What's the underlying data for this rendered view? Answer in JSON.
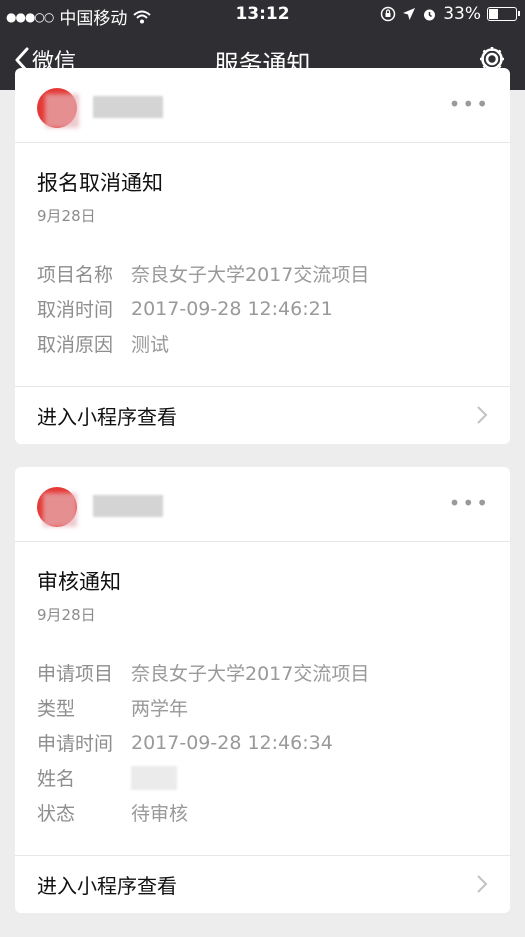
{
  "status_bar": {
    "signal_dots": "●●●○○",
    "carrier": "中国移动",
    "wifi_icon": "wifi-icon",
    "time": "13:12",
    "battery_percent": "33%",
    "battery_level": 0.33
  },
  "nav": {
    "back_label": "微信",
    "title": "服务通知",
    "settings_icon": "gear-icon"
  },
  "cards": [
    {
      "more": "•••",
      "title": "报名取消通知",
      "date": "9月28日",
      "fields": [
        {
          "key": "项目名称",
          "value": "奈良女子大学2017交流项目"
        },
        {
          "key": "取消时间",
          "value": "2017-09-28 12:46:21"
        },
        {
          "key": "取消原因",
          "value": "测试"
        }
      ],
      "footer": "进入小程序查看"
    },
    {
      "more": "•••",
      "title": "审核通知",
      "date": "9月28日",
      "fields": [
        {
          "key": "申请项目",
          "value": "奈良女子大学2017交流项目"
        },
        {
          "key": "类型",
          "value": "两学年"
        },
        {
          "key": "申请时间",
          "value": "2017-09-28 12:46:34"
        },
        {
          "key": "姓名",
          "value": ""
        },
        {
          "key": "状态",
          "value": "待审核"
        }
      ],
      "footer": "进入小程序查看"
    }
  ]
}
